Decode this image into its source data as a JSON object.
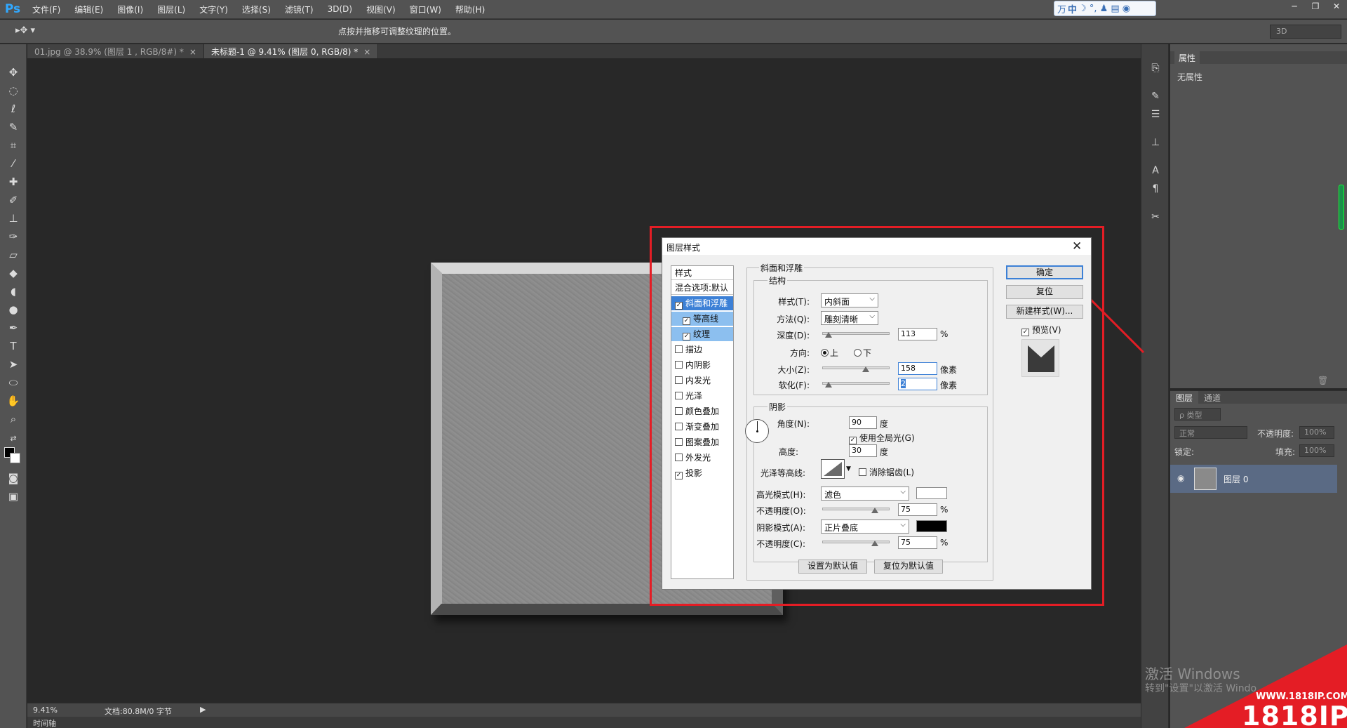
{
  "app": {
    "logo": "Ps",
    "menu": [
      "文件(F)",
      "编辑(E)",
      "图像(I)",
      "图层(L)",
      "文字(Y)",
      "选择(S)",
      "滤镜(T)",
      "3D(D)",
      "视图(V)",
      "窗口(W)",
      "帮助(H)"
    ],
    "ime": {
      "lang": "中",
      "icons": "☽ °, ♟ ▤ ◉"
    },
    "window_controls": [
      "─",
      "❐",
      "✕"
    ]
  },
  "options_bar": {
    "tool_icon": "move-icon",
    "hint": "点按并拖移可调整纹理的位置。",
    "workspace": "3D"
  },
  "tabs": [
    {
      "label": "01.jpg @ 38.9% (图层 1 , RGB/8#) *",
      "active": false
    },
    {
      "label": "未标题-1 @ 9.41% (图层 0, RGB/8) *",
      "active": true
    }
  ],
  "status": {
    "zoom": "9.41%",
    "doc": "文档:80.8M/0 字节",
    "timeline": "时间轴"
  },
  "properties_panel": {
    "tab": "属性",
    "empty": "无属性"
  },
  "layers_panel": {
    "tabs": [
      "图层",
      "通道"
    ],
    "filter": "ρ 类型",
    "blend_mode": "正常",
    "opacity_label": "不透明度:",
    "opacity_value": "100%",
    "lock_label": "锁定:",
    "fill_label": "填充:",
    "fill_value": "100%",
    "layer_name": "图层 0"
  },
  "activate_windows": {
    "title": "激活 Windows",
    "sub": "转到\"设置\"以激活 Windo"
  },
  "watermark": {
    "url": "WWW.1818IP.COM",
    "brand": "1818IP"
  },
  "dialog": {
    "title": "图层样式",
    "styles_header": "样式",
    "blend_options": "混合选项:默认",
    "effects": [
      {
        "label": "斜面和浮雕",
        "checked": true,
        "state": "selected"
      },
      {
        "label": "等高线",
        "checked": true,
        "state": "sub"
      },
      {
        "label": "纹理",
        "checked": true,
        "state": "sub"
      },
      {
        "label": "描边",
        "checked": false,
        "state": ""
      },
      {
        "label": "内阴影",
        "checked": false,
        "state": ""
      },
      {
        "label": "内发光",
        "checked": false,
        "state": ""
      },
      {
        "label": "光泽",
        "checked": false,
        "state": ""
      },
      {
        "label": "颜色叠加",
        "checked": false,
        "state": ""
      },
      {
        "label": "渐变叠加",
        "checked": false,
        "state": ""
      },
      {
        "label": "图案叠加",
        "checked": false,
        "state": ""
      },
      {
        "label": "外发光",
        "checked": false,
        "state": ""
      },
      {
        "label": "投影",
        "checked": true,
        "state": ""
      }
    ],
    "bevel": {
      "section": "斜面和浮雕",
      "structure": "结构",
      "style_label": "样式(T):",
      "style_value": "内斜面",
      "technique_label": "方法(Q):",
      "technique_value": "雕刻清晰",
      "depth_label": "深度(D):",
      "depth_value": "113",
      "depth_unit": "%",
      "direction_label": "方向:",
      "dir_up": "上",
      "dir_down": "下",
      "size_label": "大小(Z):",
      "size_value": "158",
      "size_unit": "像素",
      "soften_label": "软化(F):",
      "soften_value": "2",
      "soften_unit": "像素"
    },
    "shading": {
      "section": "阴影",
      "angle_label": "角度(N):",
      "angle_value": "90",
      "angle_unit": "度",
      "global_light": "使用全局光(G)",
      "altitude_label": "高度:",
      "altitude_value": "30",
      "altitude_unit": "度",
      "gloss_label": "光泽等高线:",
      "antialias": "消除锯齿(L)",
      "highlight_mode_label": "高光模式(H):",
      "highlight_mode": "滤色",
      "highlight_opacity_label": "不透明度(O):",
      "highlight_opacity": "75",
      "highlight_unit": "%",
      "shadow_mode_label": "阴影模式(A):",
      "shadow_mode": "正片叠底",
      "shadow_opacity_label": "不透明度(C):",
      "shadow_opacity": "75",
      "shadow_unit": "%",
      "highlight_color": "#ffffff",
      "shadow_color": "#000000"
    },
    "make_default": "设置为默认值",
    "reset_default": "复位为默认值",
    "ok": "确定",
    "reset": "复位",
    "new_style": "新建样式(W)...",
    "preview": "预览(V)"
  }
}
